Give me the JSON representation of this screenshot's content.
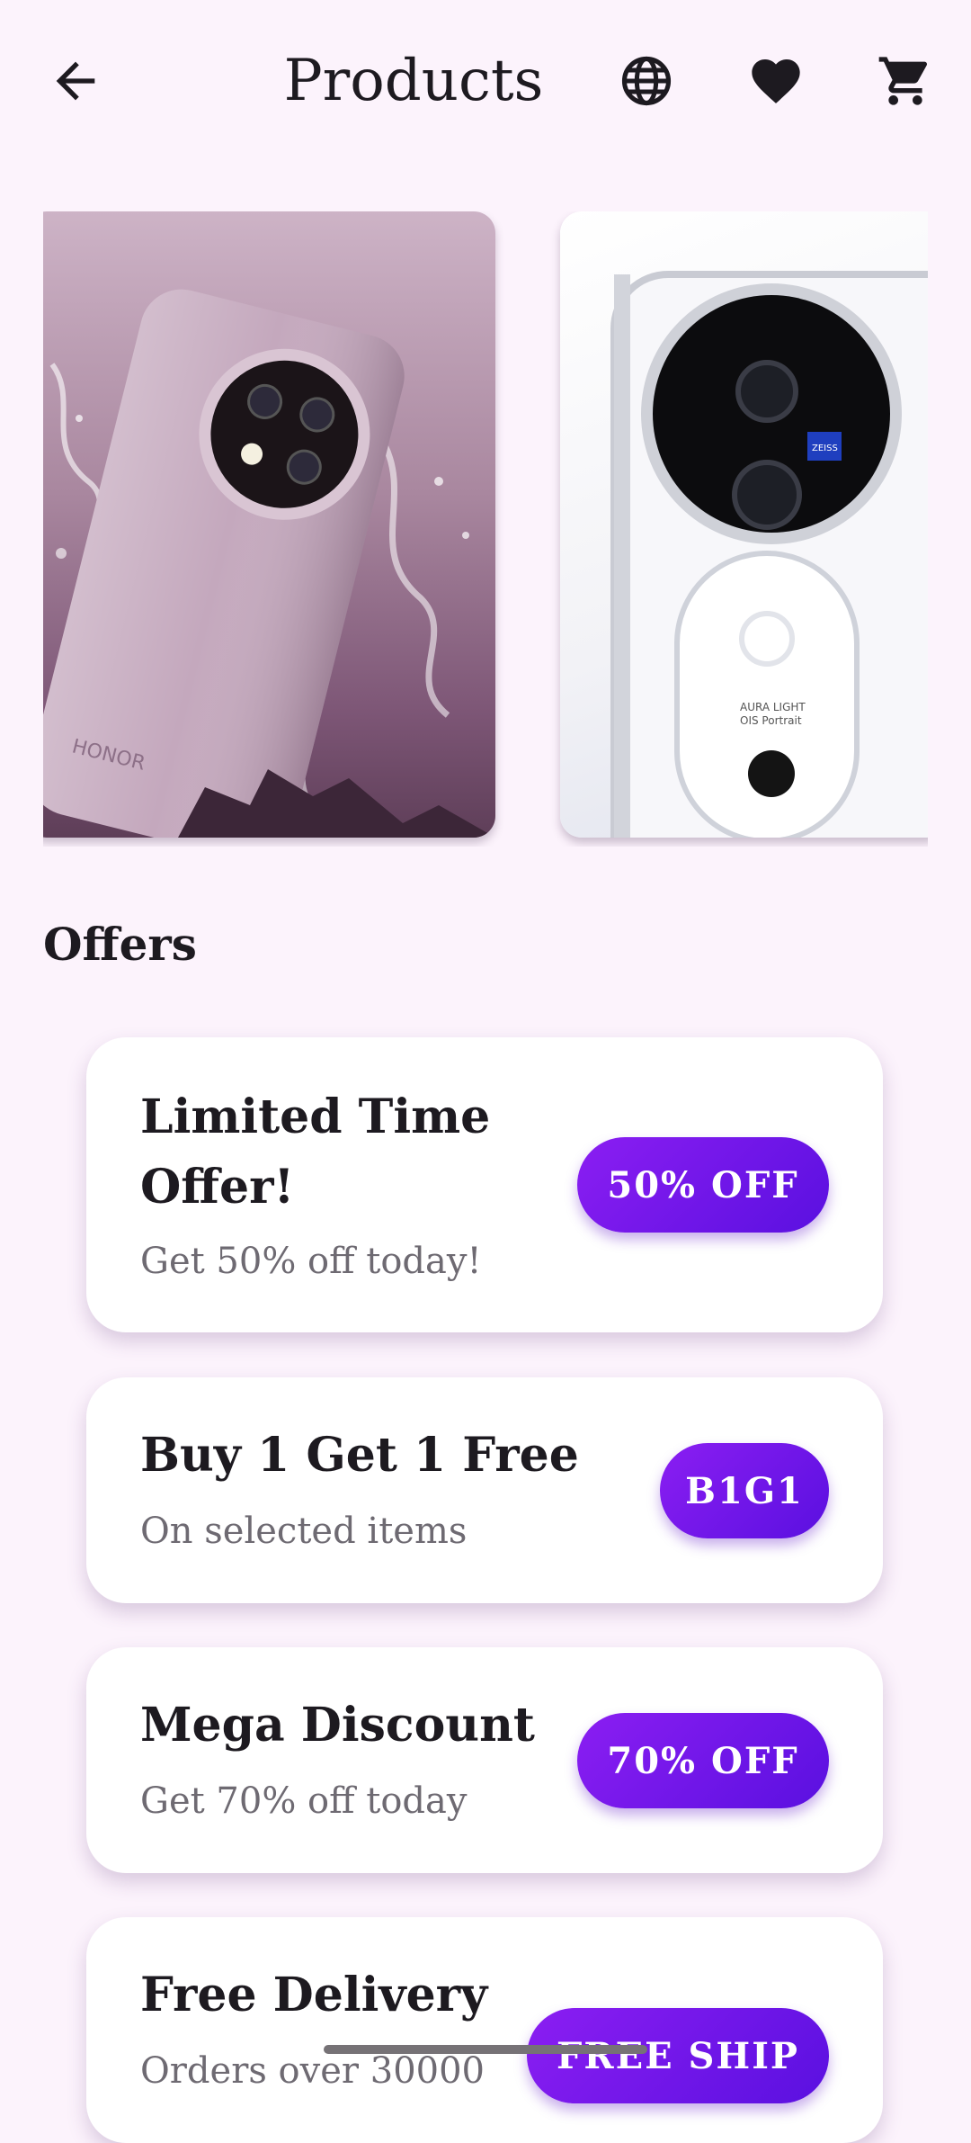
{
  "header": {
    "title": "Products",
    "icons": [
      "back-arrow-icon",
      "globe-icon",
      "heart-icon",
      "cart-icon"
    ]
  },
  "carousel": {
    "items": [
      {
        "brand_text": "HONOR"
      },
      {
        "brand_text": "ZEISS",
        "camera_text": "AURA LIGHT OIS Portrait"
      }
    ]
  },
  "offers_section": {
    "title": "Offers",
    "items": [
      {
        "title": "Limited Time Offer!",
        "subtitle": "Get 50% off today!",
        "badge": "50% OFF"
      },
      {
        "title": "Buy 1 Get 1 Free",
        "subtitle": "On selected items",
        "badge": "B1G1"
      },
      {
        "title": "Mega Discount",
        "subtitle": "Get 70% off today",
        "badge": "70% OFF"
      },
      {
        "title": "Free Delivery",
        "subtitle": "Orders over 30000",
        "badge": "FREE SHIP"
      }
    ]
  },
  "colors": {
    "background": "#fcf3fc",
    "accent": "#6a14e8",
    "card": "#ffffff"
  }
}
